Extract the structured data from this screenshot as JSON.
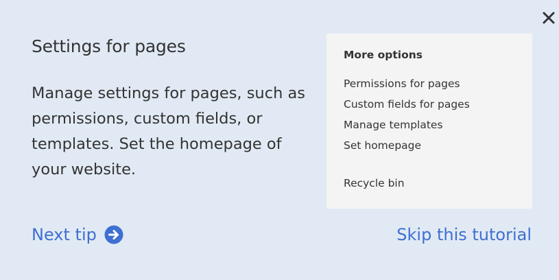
{
  "dialog": {
    "title": "Settings for pages",
    "description": "Manage settings for pages, such as permissions, custom fields, or templates. Set the homepage of your website.",
    "close_icon": "close-icon"
  },
  "more_options": {
    "heading": "More options",
    "items": [
      "Permissions for pages",
      "Custom fields for pages",
      "Manage templates",
      "Set homepage",
      "Recycle bin"
    ]
  },
  "footer": {
    "next_tip_label": "Next tip",
    "next_tip_icon": "arrow-right-circle-icon",
    "skip_label": "Skip this tutorial"
  },
  "colors": {
    "background": "#e1eaf4",
    "panel": "#f4f4f4",
    "link": "#3f6fd1",
    "text": "#333333"
  }
}
